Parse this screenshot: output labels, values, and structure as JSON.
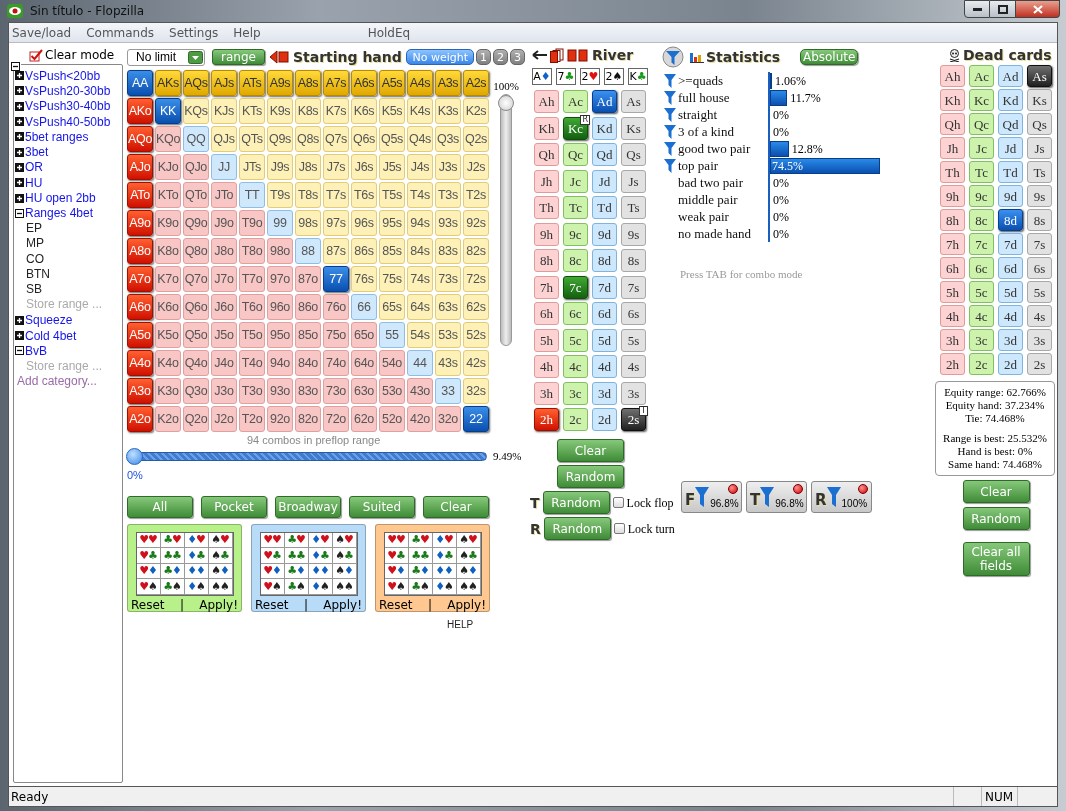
{
  "window": {
    "title": "Sin título - Flopzilla"
  },
  "menu": [
    {
      "label": "Save/load"
    },
    {
      "label": "Commands"
    },
    {
      "label": "Settings"
    },
    {
      "label": "Help"
    },
    {
      "label": "HoldEq"
    }
  ],
  "sidebar": {
    "header": "Clear mode",
    "tree_expanded": true,
    "items": [
      {
        "kind": "category",
        "label": "VsPush<20bb",
        "expanded": false
      },
      {
        "kind": "category",
        "label": "VsPush20-30bb",
        "expanded": false
      },
      {
        "kind": "category",
        "label": "VsPush30-40bb",
        "expanded": false
      },
      {
        "kind": "category",
        "label": "VsPush40-50bb",
        "expanded": false
      },
      {
        "kind": "category",
        "label": "5bet ranges",
        "expanded": false
      },
      {
        "kind": "category",
        "label": "3bet",
        "expanded": false
      },
      {
        "kind": "category",
        "label": "OR",
        "expanded": false
      },
      {
        "kind": "category",
        "label": "HU",
        "expanded": false
      },
      {
        "kind": "category",
        "label": "HU open 2bb",
        "expanded": false
      },
      {
        "kind": "category",
        "label": "Ranges 4bet",
        "expanded": true,
        "children": [
          {
            "kind": "range",
            "label": "EP"
          },
          {
            "kind": "range",
            "label": "MP"
          },
          {
            "kind": "range",
            "label": "CO"
          },
          {
            "kind": "range",
            "label": "BTN"
          },
          {
            "kind": "range",
            "label": "SB"
          },
          {
            "kind": "store",
            "label": "Store range ..."
          }
        ]
      },
      {
        "kind": "category",
        "label": "Squeeze",
        "expanded": false
      },
      {
        "kind": "category",
        "label": "Cold 4bet",
        "expanded": false
      },
      {
        "kind": "category",
        "label": "BvB",
        "expanded": true,
        "children": [
          {
            "kind": "store",
            "label": "Store range ..."
          }
        ]
      },
      {
        "kind": "add",
        "label": "Add category..."
      }
    ]
  },
  "hand": {
    "game": "No limit",
    "range_button": "range",
    "title": "Starting hand",
    "weights": [
      {
        "label": "No weight",
        "selected": true
      },
      {
        "label": "1",
        "selected": false
      },
      {
        "label": "2",
        "selected": false
      },
      {
        "label": "3",
        "selected": false
      }
    ],
    "rows": [
      {
        "cells": [
          {
            "label": "AA",
            "selected": true
          },
          {
            "label": "AKs",
            "selected": true
          },
          {
            "label": "AQs",
            "selected": true
          },
          {
            "label": "AJs",
            "selected": true
          },
          {
            "label": "ATs",
            "selected": true
          },
          {
            "label": "A9s",
            "selected": true
          },
          {
            "label": "A8s",
            "selected": true
          },
          {
            "label": "A7s",
            "selected": true
          },
          {
            "label": "A6s",
            "selected": true
          },
          {
            "label": "A5s",
            "selected": true
          },
          {
            "label": "A4s",
            "selected": true
          },
          {
            "label": "A3s",
            "selected": true
          },
          {
            "label": "A2s",
            "selected": true
          }
        ]
      },
      {
        "cells": [
          {
            "label": "AKo",
            "selected": true
          },
          {
            "label": "KK",
            "selected": true
          },
          {
            "label": "KQs",
            "selected": false
          },
          {
            "label": "KJs",
            "selected": false
          },
          {
            "label": "KTs",
            "selected": false
          },
          {
            "label": "K9s",
            "selected": false
          },
          {
            "label": "K8s",
            "selected": false
          },
          {
            "label": "K7s",
            "selected": false
          },
          {
            "label": "K6s",
            "selected": false
          },
          {
            "label": "K5s",
            "selected": false
          },
          {
            "label": "K4s",
            "selected": false
          },
          {
            "label": "K3s",
            "selected": false
          },
          {
            "label": "K2s",
            "selected": false
          }
        ]
      },
      {
        "cells": [
          {
            "label": "AQo",
            "selected": true
          },
          {
            "label": "KQo",
            "selected": false
          },
          {
            "label": "QQ",
            "selected": false
          },
          {
            "label": "QJs",
            "selected": false
          },
          {
            "label": "QTs",
            "selected": false
          },
          {
            "label": "Q9s",
            "selected": false
          },
          {
            "label": "Q8s",
            "selected": false
          },
          {
            "label": "Q7s",
            "selected": false
          },
          {
            "label": "Q6s",
            "selected": false
          },
          {
            "label": "Q5s",
            "selected": false
          },
          {
            "label": "Q4s",
            "selected": false
          },
          {
            "label": "Q3s",
            "selected": false
          },
          {
            "label": "Q2s",
            "selected": false
          }
        ]
      },
      {
        "cells": [
          {
            "label": "AJo",
            "selected": true
          },
          {
            "label": "KJo",
            "selected": false
          },
          {
            "label": "QJo",
            "selected": false
          },
          {
            "label": "JJ",
            "selected": false
          },
          {
            "label": "JTs",
            "selected": false
          },
          {
            "label": "J9s",
            "selected": false
          },
          {
            "label": "J8s",
            "selected": false
          },
          {
            "label": "J7s",
            "selected": false
          },
          {
            "label": "J6s",
            "selected": false
          },
          {
            "label": "J5s",
            "selected": false
          },
          {
            "label": "J4s",
            "selected": false
          },
          {
            "label": "J3s",
            "selected": false
          },
          {
            "label": "J2s",
            "selected": false
          }
        ]
      },
      {
        "cells": [
          {
            "label": "ATo",
            "selected": true
          },
          {
            "label": "KTo",
            "selected": false
          },
          {
            "label": "QTo",
            "selected": false
          },
          {
            "label": "JTo",
            "selected": false
          },
          {
            "label": "TT",
            "selected": false
          },
          {
            "label": "T9s",
            "selected": false
          },
          {
            "label": "T8s",
            "selected": false
          },
          {
            "label": "T7s",
            "selected": false
          },
          {
            "label": "T6s",
            "selected": false
          },
          {
            "label": "T5s",
            "selected": false
          },
          {
            "label": "T4s",
            "selected": false
          },
          {
            "label": "T3s",
            "selected": false
          },
          {
            "label": "T2s",
            "selected": false
          }
        ]
      },
      {
        "cells": [
          {
            "label": "A9o",
            "selected": true
          },
          {
            "label": "K9o",
            "selected": false
          },
          {
            "label": "Q9o",
            "selected": false
          },
          {
            "label": "J9o",
            "selected": false
          },
          {
            "label": "T9o",
            "selected": false
          },
          {
            "label": "99",
            "selected": false
          },
          {
            "label": "98s",
            "selected": false
          },
          {
            "label": "97s",
            "selected": false
          },
          {
            "label": "96s",
            "selected": false
          },
          {
            "label": "95s",
            "selected": false
          },
          {
            "label": "94s",
            "selected": false
          },
          {
            "label": "93s",
            "selected": false
          },
          {
            "label": "92s",
            "selected": false
          }
        ]
      },
      {
        "cells": [
          {
            "label": "A8o",
            "selected": true
          },
          {
            "label": "K8o",
            "selected": false
          },
          {
            "label": "Q8o",
            "selected": false
          },
          {
            "label": "J8o",
            "selected": false
          },
          {
            "label": "T8o",
            "selected": false
          },
          {
            "label": "98o",
            "selected": false
          },
          {
            "label": "88",
            "selected": false
          },
          {
            "label": "87s",
            "selected": false
          },
          {
            "label": "86s",
            "selected": false
          },
          {
            "label": "85s",
            "selected": false
          },
          {
            "label": "84s",
            "selected": false
          },
          {
            "label": "83s",
            "selected": false
          },
          {
            "label": "82s",
            "selected": false
          }
        ]
      },
      {
        "cells": [
          {
            "label": "A7o",
            "selected": true
          },
          {
            "label": "K7o",
            "selected": false
          },
          {
            "label": "Q7o",
            "selected": false
          },
          {
            "label": "J7o",
            "selected": false
          },
          {
            "label": "T7o",
            "selected": false
          },
          {
            "label": "97o",
            "selected": false
          },
          {
            "label": "87o",
            "selected": false
          },
          {
            "label": "77",
            "selected": true
          },
          {
            "label": "76s",
            "selected": false
          },
          {
            "label": "75s",
            "selected": false
          },
          {
            "label": "74s",
            "selected": false
          },
          {
            "label": "73s",
            "selected": false
          },
          {
            "label": "72s",
            "selected": false
          }
        ]
      },
      {
        "cells": [
          {
            "label": "A6o",
            "selected": true
          },
          {
            "label": "K6o",
            "selected": false
          },
          {
            "label": "Q6o",
            "selected": false
          },
          {
            "label": "J6o",
            "selected": false
          },
          {
            "label": "T6o",
            "selected": false
          },
          {
            "label": "96o",
            "selected": false
          },
          {
            "label": "86o",
            "selected": false
          },
          {
            "label": "76o",
            "selected": false
          },
          {
            "label": "66",
            "selected": false
          },
          {
            "label": "65s",
            "selected": false
          },
          {
            "label": "64s",
            "selected": false
          },
          {
            "label": "63s",
            "selected": false
          },
          {
            "label": "62s",
            "selected": false
          }
        ]
      },
      {
        "cells": [
          {
            "label": "A5o",
            "selected": true
          },
          {
            "label": "K5o",
            "selected": false
          },
          {
            "label": "Q5o",
            "selected": false
          },
          {
            "label": "J5o",
            "selected": false
          },
          {
            "label": "T5o",
            "selected": false
          },
          {
            "label": "95o",
            "selected": false
          },
          {
            "label": "85o",
            "selected": false
          },
          {
            "label": "75o",
            "selected": false
          },
          {
            "label": "65o",
            "selected": false
          },
          {
            "label": "55",
            "selected": false
          },
          {
            "label": "54s",
            "selected": false
          },
          {
            "label": "53s",
            "selected": false
          },
          {
            "label": "52s",
            "selected": false
          }
        ]
      },
      {
        "cells": [
          {
            "label": "A4o",
            "selected": true
          },
          {
            "label": "K4o",
            "selected": false
          },
          {
            "label": "Q4o",
            "selected": false
          },
          {
            "label": "J4o",
            "selected": false
          },
          {
            "label": "T4o",
            "selected": false
          },
          {
            "label": "94o",
            "selected": false
          },
          {
            "label": "84o",
            "selected": false
          },
          {
            "label": "74o",
            "selected": false
          },
          {
            "label": "64o",
            "selected": false
          },
          {
            "label": "54o",
            "selected": false
          },
          {
            "label": "44",
            "selected": false
          },
          {
            "label": "43s",
            "selected": false
          },
          {
            "label": "42s",
            "selected": false
          }
        ]
      },
      {
        "cells": [
          {
            "label": "A3o",
            "selected": true
          },
          {
            "label": "K3o",
            "selected": false
          },
          {
            "label": "Q3o",
            "selected": false
          },
          {
            "label": "J3o",
            "selected": false
          },
          {
            "label": "T3o",
            "selected": false
          },
          {
            "label": "93o",
            "selected": false
          },
          {
            "label": "83o",
            "selected": false
          },
          {
            "label": "73o",
            "selected": false
          },
          {
            "label": "63o",
            "selected": false
          },
          {
            "label": "53o",
            "selected": false
          },
          {
            "label": "43o",
            "selected": false
          },
          {
            "label": "33",
            "selected": false
          },
          {
            "label": "32s",
            "selected": false
          }
        ]
      },
      {
        "cells": [
          {
            "label": "A2o",
            "selected": true
          },
          {
            "label": "K2o",
            "selected": false
          },
          {
            "label": "Q2o",
            "selected": false
          },
          {
            "label": "J2o",
            "selected": false
          },
          {
            "label": "T2o",
            "selected": false
          },
          {
            "label": "92o",
            "selected": false
          },
          {
            "label": "82o",
            "selected": false
          },
          {
            "label": "72o",
            "selected": false
          },
          {
            "label": "62o",
            "selected": false
          },
          {
            "label": "52o",
            "selected": false
          },
          {
            "label": "42o",
            "selected": false
          },
          {
            "label": "32o",
            "selected": false
          },
          {
            "label": "22",
            "selected": true
          }
        ]
      }
    ],
    "weight_slider": {
      "reading": "100%",
      "level": 1
    },
    "combos": "94 combos in preflop range",
    "range_slider": {
      "min_label": "0%",
      "reading": "9.49%",
      "level": 0
    },
    "buttons": [
      {
        "label": "All"
      },
      {
        "label": "Pocket"
      },
      {
        "label": "Broadway"
      },
      {
        "label": "Suited"
      },
      {
        "label": "Clear"
      }
    ],
    "suit_boxes": [
      {
        "color": "#b8f08a",
        "cells": [
          "♥♥",
          "♣♥",
          "♦♥",
          "♠♥",
          "♥♣",
          "♣♣",
          "♦♣",
          "♠♣",
          "♥♦",
          "♣♦",
          "♦♦",
          "♠♦",
          "♥♠",
          "♣♠",
          "♦♠",
          "♠♠"
        ],
        "reset": "Reset",
        "separator": "|",
        "apply": "Apply!"
      },
      {
        "color": "#b8dcf8",
        "cells": [
          "♥♥",
          "♣♥",
          "♦♥",
          "♠♥",
          "♥♣",
          "♣♣",
          "♦♣",
          "♠♣",
          "♥♦",
          "♣♦",
          "♦♦",
          "♠♦",
          "♥♠",
          "♣♠",
          "♦♠",
          "♠♠"
        ],
        "reset": "Reset",
        "separator": "|",
        "apply": "Apply!"
      },
      {
        "color": "#ffc890",
        "cells": [
          "♥♥",
          "♣♥",
          "♦♥",
          "♠♥",
          "♥♣",
          "♣♣",
          "♦♣",
          "♠♣",
          "♥♦",
          "♣♦",
          "♦♦",
          "♠♦",
          "♥♠",
          "♣♠",
          "♦♠",
          "♠♠"
        ],
        "reset": "Reset",
        "separator": "|",
        "apply": "Apply!"
      }
    ],
    "help": "HELP"
  },
  "river": {
    "title": "River",
    "board": [
      {
        "rank": "A",
        "suit": "♦",
        "color": "#1060d0"
      },
      {
        "rank": "7",
        "suit": "♣",
        "color": "#1a9a1a"
      },
      {
        "rank": "2",
        "suit": "♥",
        "color": "#e01010"
      },
      {
        "rank": "2",
        "suit": "♠",
        "color": "#111111"
      },
      {
        "rank": "K",
        "suit": "♣",
        "color": "#1a9a1a"
      }
    ],
    "rows": [
      {
        "cards": [
          {
            "label": "Ah",
            "selected": false
          },
          {
            "label": "Ac",
            "selected": false
          },
          {
            "label": "Ad",
            "selected": true
          },
          {
            "label": "As",
            "selected": false
          }
        ]
      },
      {
        "cards": [
          {
            "label": "Kh",
            "selected": false
          },
          {
            "label": "Kc",
            "selected": true,
            "badge": "R"
          },
          {
            "label": "Kd",
            "selected": false
          },
          {
            "label": "Ks",
            "selected": false
          }
        ]
      },
      {
        "cards": [
          {
            "label": "Qh",
            "selected": false
          },
          {
            "label": "Qc",
            "selected": false
          },
          {
            "label": "Qd",
            "selected": false
          },
          {
            "label": "Qs",
            "selected": false
          }
        ]
      },
      {
        "cards": [
          {
            "label": "Jh",
            "selected": false
          },
          {
            "label": "Jc",
            "selected": false
          },
          {
            "label": "Jd",
            "selected": false
          },
          {
            "label": "Js",
            "selected": false
          }
        ]
      },
      {
        "cards": [
          {
            "label": "Th",
            "selected": false
          },
          {
            "label": "Tc",
            "selected": false
          },
          {
            "label": "Td",
            "selected": false
          },
          {
            "label": "Ts",
            "selected": false
          }
        ]
      },
      {
        "cards": [
          {
            "label": "9h",
            "selected": false
          },
          {
            "label": "9c",
            "selected": false
          },
          {
            "label": "9d",
            "selected": false
          },
          {
            "label": "9s",
            "selected": false
          }
        ]
      },
      {
        "cards": [
          {
            "label": "8h",
            "selected": false
          },
          {
            "label": "8c",
            "selected": false
          },
          {
            "label": "8d",
            "selected": false
          },
          {
            "label": "8s",
            "selected": false
          }
        ]
      },
      {
        "cards": [
          {
            "label": "7h",
            "selected": false
          },
          {
            "label": "7c",
            "selected": true
          },
          {
            "label": "7d",
            "selected": false
          },
          {
            "label": "7s",
            "selected": false
          }
        ]
      },
      {
        "cards": [
          {
            "label": "6h",
            "selected": false
          },
          {
            "label": "6c",
            "selected": false
          },
          {
            "label": "6d",
            "selected": false
          },
          {
            "label": "6s",
            "selected": false
          }
        ]
      },
      {
        "cards": [
          {
            "label": "5h",
            "selected": false
          },
          {
            "label": "5c",
            "selected": false
          },
          {
            "label": "5d",
            "selected": false
          },
          {
            "label": "5s",
            "selected": false
          }
        ]
      },
      {
        "cards": [
          {
            "label": "4h",
            "selected": false
          },
          {
            "label": "4c",
            "selected": false
          },
          {
            "label": "4d",
            "selected": false
          },
          {
            "label": "4s",
            "selected": false
          }
        ]
      },
      {
        "cards": [
          {
            "label": "3h",
            "selected": false
          },
          {
            "label": "3c",
            "selected": false
          },
          {
            "label": "3d",
            "selected": false
          },
          {
            "label": "3s",
            "selected": false
          }
        ]
      },
      {
        "cards": [
          {
            "label": "2h",
            "selected": true
          },
          {
            "label": "2c",
            "selected": false
          },
          {
            "label": "2d",
            "selected": false
          },
          {
            "label": "2s",
            "selected": true,
            "badge": "T"
          }
        ]
      }
    ],
    "clear": "Clear",
    "random": "Random",
    "street_random": [
      {
        "letter": "T",
        "button": "Random",
        "lock": "Lock flop",
        "checked": false
      },
      {
        "letter": "R",
        "button": "Random",
        "lock": "Lock turn",
        "checked": false
      }
    ]
  },
  "statistics": {
    "title": "Statistics",
    "mode_button": "Absolute",
    "rows": [
      {
        "label": ">=quads",
        "value": "1.06%",
        "level": 0.0106,
        "filter": true
      },
      {
        "label": "full house",
        "value": "11.7%",
        "level": 0.117,
        "filter": true
      },
      {
        "label": "straight",
        "value": "0%",
        "filter": true
      },
      {
        "label": "3 of a kind",
        "value": "0%",
        "filter": true
      },
      {
        "label": "good two pair",
        "value": "12.8%",
        "level": 0.128,
        "filter": true
      },
      {
        "label": "top pair",
        "value": "74.5%",
        "level": 0.745,
        "filter": true
      },
      {
        "label": "bad two pair",
        "value": "0%",
        "filter": false
      },
      {
        "label": "middle pair",
        "value": "0%",
        "filter": false
      },
      {
        "label": "weak pair",
        "value": "0%",
        "filter": false
      },
      {
        "label": "no made hand",
        "value": "0%",
        "filter": false
      }
    ],
    "hint": "Press TAB for combo mode",
    "filters": [
      {
        "letter": "F",
        "value": "96.8%",
        "alert": true
      },
      {
        "letter": "T",
        "value": "96.8%",
        "alert": true
      },
      {
        "letter": "R",
        "value": "100%",
        "alert": true
      }
    ]
  },
  "dead_cards": {
    "title": "Dead cards",
    "rows": [
      {
        "cards": [
          {
            "label": "Ah",
            "selected": false
          },
          {
            "label": "Ac",
            "selected": false
          },
          {
            "label": "Ad",
            "selected": false
          },
          {
            "label": "As",
            "selected": true
          }
        ]
      },
      {
        "cards": [
          {
            "label": "Kh",
            "selected": false
          },
          {
            "label": "Kc",
            "selected": false
          },
          {
            "label": "Kd",
            "selected": false
          },
          {
            "label": "Ks",
            "selected": false
          }
        ]
      },
      {
        "cards": [
          {
            "label": "Qh",
            "selected": false
          },
          {
            "label": "Qc",
            "selected": false
          },
          {
            "label": "Qd",
            "selected": false
          },
          {
            "label": "Qs",
            "selected": false
          }
        ]
      },
      {
        "cards": [
          {
            "label": "Jh",
            "selected": false
          },
          {
            "label": "Jc",
            "selected": false
          },
          {
            "label": "Jd",
            "selected": false
          },
          {
            "label": "Js",
            "selected": false
          }
        ]
      },
      {
        "cards": [
          {
            "label": "Th",
            "selected": false
          },
          {
            "label": "Tc",
            "selected": false
          },
          {
            "label": "Td",
            "selected": false
          },
          {
            "label": "Ts",
            "selected": false
          }
        ]
      },
      {
        "cards": [
          {
            "label": "9h",
            "selected": false
          },
          {
            "label": "9c",
            "selected": false
          },
          {
            "label": "9d",
            "selected": false
          },
          {
            "label": "9s",
            "selected": false
          }
        ]
      },
      {
        "cards": [
          {
            "label": "8h",
            "selected": false
          },
          {
            "label": "8c",
            "selected": false
          },
          {
            "label": "8d",
            "selected": true
          },
          {
            "label": "8s",
            "selected": false
          }
        ]
      },
      {
        "cards": [
          {
            "label": "7h",
            "selected": false
          },
          {
            "label": "7c",
            "selected": false
          },
          {
            "label": "7d",
            "selected": false
          },
          {
            "label": "7s",
            "selected": false
          }
        ]
      },
      {
        "cards": [
          {
            "label": "6h",
            "selected": false
          },
          {
            "label": "6c",
            "selected": false
          },
          {
            "label": "6d",
            "selected": false
          },
          {
            "label": "6s",
            "selected": false
          }
        ]
      },
      {
        "cards": [
          {
            "label": "5h",
            "selected": false
          },
          {
            "label": "5c",
            "selected": false
          },
          {
            "label": "5d",
            "selected": false
          },
          {
            "label": "5s",
            "selected": false
          }
        ]
      },
      {
        "cards": [
          {
            "label": "4h",
            "selected": false
          },
          {
            "label": "4c",
            "selected": false
          },
          {
            "label": "4d",
            "selected": false
          },
          {
            "label": "4s",
            "selected": false
          }
        ]
      },
      {
        "cards": [
          {
            "label": "3h",
            "selected": false
          },
          {
            "label": "3c",
            "selected": false
          },
          {
            "label": "3d",
            "selected": false
          },
          {
            "label": "3s",
            "selected": false
          }
        ]
      },
      {
        "cards": [
          {
            "label": "2h",
            "selected": false
          },
          {
            "label": "2c",
            "selected": false
          },
          {
            "label": "2d",
            "selected": false
          },
          {
            "label": "2s",
            "selected": false
          }
        ]
      }
    ],
    "equity": [
      [
        "Equity range: 62.766%",
        "Equity hand: 37.234%",
        "Tie: 74.468%"
      ],
      [
        "Range is best: 25.532%",
        "Hand is best: 0%",
        "Same hand: 74.468%"
      ]
    ],
    "buttons": [
      {
        "label": "Clear"
      },
      {
        "label": "Random"
      },
      {
        "label": "Clear all fields"
      }
    ]
  },
  "status_bar": {
    "text": "Ready",
    "indicator": "NUM"
  }
}
